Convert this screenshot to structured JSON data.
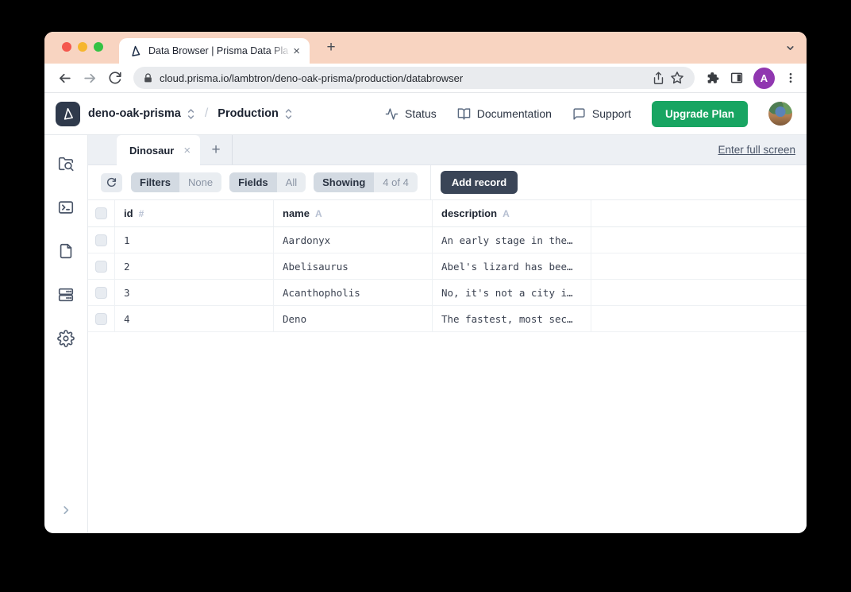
{
  "browser": {
    "tab_title": "Data Browser | Prisma Data Pla",
    "tab_close": "×",
    "new_tab": "+",
    "url": "cloud.prisma.io/lambtron/deno-oak-prisma/production/databrowser",
    "profile_initial": "A"
  },
  "header": {
    "project": "deno-oak-prisma",
    "separator": "/",
    "environment": "Production",
    "status": "Status",
    "documentation": "Documentation",
    "support": "Support",
    "upgrade": "Upgrade Plan"
  },
  "tabbar": {
    "active_tab": "Dinosaur",
    "close": "×",
    "add": "+",
    "fullscreen": "Enter full screen"
  },
  "toolbar": {
    "filters_label": "Filters",
    "filters_value": "None",
    "fields_label": "Fields",
    "fields_value": "All",
    "showing_label": "Showing",
    "showing_value": "4 of 4",
    "add_record": "Add record"
  },
  "table": {
    "columns": [
      {
        "label": "id",
        "type_icon": "#"
      },
      {
        "label": "name",
        "type_icon": "A"
      },
      {
        "label": "description",
        "type_icon": "A"
      }
    ],
    "rows": [
      {
        "id": "1",
        "name": "Aardonyx",
        "description": "An early stage in the…"
      },
      {
        "id": "2",
        "name": "Abelisaurus",
        "description": "Abel's lizard has bee…"
      },
      {
        "id": "3",
        "name": "Acanthopholis",
        "description": "No, it's not a city i…"
      },
      {
        "id": "4",
        "name": "Deno",
        "description": "The fastest, most sec…"
      }
    ]
  },
  "sidebar": {
    "icons": [
      "data-browser",
      "query-console",
      "schema-viewer",
      "databases",
      "settings"
    ]
  },
  "colors": {
    "chrome_peach": "#F8D4C1",
    "accent_green": "#18A562",
    "dark_button": "#3A4557",
    "profile_purple": "#9037B0",
    "traffic_red": "#F4574D",
    "traffic_yellow": "#F6B62E",
    "traffic_green": "#34C244"
  }
}
